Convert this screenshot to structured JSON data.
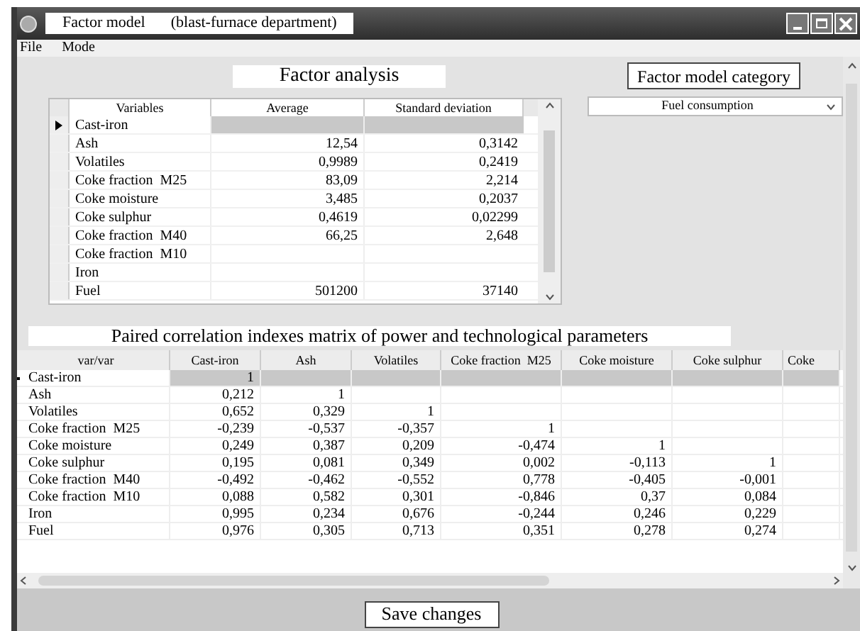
{
  "window": {
    "title": "Factor model",
    "subtitle": "(blast-furnace department)"
  },
  "menu": [
    "File",
    "Mode"
  ],
  "factor_analysis": {
    "heading": "Factor analysis",
    "columns": [
      "Variables",
      "Average",
      "Standard deviation"
    ],
    "rows": [
      {
        "variable": "Cast-iron",
        "selected": true
      },
      {
        "variable": "Ash",
        "average": "12,54",
        "deviation": "0,3142",
        "selected": false
      },
      {
        "variable": "Volatiles",
        "average": "0,9989",
        "deviation": "0,2419",
        "selected": false
      },
      {
        "variable": "Coke fraction  M25",
        "average": "83,09",
        "deviation": "2,214",
        "selected": false
      },
      {
        "variable": "Coke moisture",
        "average": "3,485",
        "deviation": "0,2037",
        "selected": false
      },
      {
        "variable": "Coke sulphur",
        "average": "0,4619",
        "deviation": "0,02299",
        "selected": false
      },
      {
        "variable": "Coke fraction  M40",
        "average": "66,25",
        "deviation": "2,648",
        "selected": false
      },
      {
        "variable": "Coke fraction  M10",
        "selected": false
      },
      {
        "variable": "Iron",
        "selected": false
      },
      {
        "variable": "Fuel",
        "average": "501200",
        "deviation": "37140",
        "selected": false
      }
    ]
  },
  "category": {
    "label": "Factor model category",
    "value": "Fuel consumption"
  },
  "matrix": {
    "heading": "Paired correlation indexes matrix of power and technological parameters",
    "columns": [
      "var/var",
      "Cast-iron",
      "Ash",
      "Volatiles",
      "Coke fraction  M25",
      "Coke moisture",
      "Coke sulphur",
      "Coke"
    ],
    "rows": [
      {
        "name": "Cast-iron",
        "values": [
          "1"
        ],
        "selected": true
      },
      {
        "name": "Ash",
        "values": [
          "0,212",
          "1"
        ],
        "selected": false
      },
      {
        "name": "Volatiles",
        "values": [
          "0,652",
          "0,329",
          "1"
        ],
        "selected": false
      },
      {
        "name": "Coke fraction  M25",
        "values": [
          "-0,239",
          "-0,537",
          "-0,357",
          "1"
        ],
        "selected": false
      },
      {
        "name": "Coke moisture",
        "values": [
          "0,249",
          "0,387",
          "0,209",
          "-0,474",
          "1"
        ],
        "selected": false
      },
      {
        "name": "Coke sulphur",
        "values": [
          "0,195",
          "0,081",
          "0,349",
          "0,002",
          "-0,113",
          "1"
        ],
        "selected": false
      },
      {
        "name": "Coke fraction  M40",
        "values": [
          "-0,492",
          "-0,462",
          "-0,552",
          "0,778",
          "-0,405",
          "-0,001"
        ],
        "selected": false
      },
      {
        "name": "Coke fraction  M10",
        "values": [
          "0,088",
          "0,582",
          "0,301",
          "-0,846",
          "0,37",
          "0,084"
        ],
        "selected": false
      },
      {
        "name": "Iron",
        "values": [
          "0,995",
          "0,234",
          "0,676",
          "-0,244",
          "0,246",
          "0,229"
        ],
        "selected": false
      },
      {
        "name": "Fuel",
        "values": [
          "0,976",
          "0,305",
          "0,713",
          "0,351",
          "0,278",
          "0,274"
        ],
        "selected": false
      }
    ]
  },
  "save_button": "Save changes"
}
